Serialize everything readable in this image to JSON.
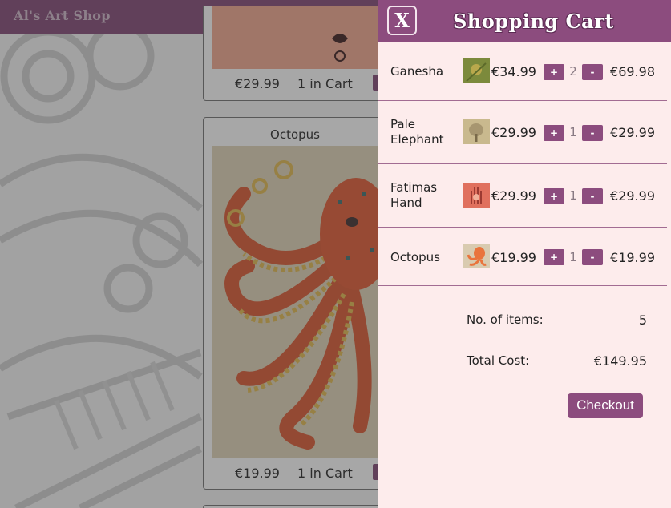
{
  "shop": {
    "brand": "Al's Art Shop",
    "products": [
      {
        "price": "€29.99",
        "in_cart": "1 in Cart"
      },
      {
        "title": "Octopus",
        "price": "€19.99",
        "in_cart": "1 in Cart"
      }
    ]
  },
  "cart": {
    "close_label": "X",
    "title": "Shopping Cart",
    "plus_label": "+",
    "minus_label": "-",
    "items": [
      {
        "name": "Ganesha",
        "unit_price": "€34.99",
        "qty": "2",
        "line_total": "€69.98",
        "thumb_color": "#7c8a3c"
      },
      {
        "name": "Pale Elephant",
        "unit_price": "€29.99",
        "qty": "1",
        "line_total": "€29.99",
        "thumb_color": "#c9b98e"
      },
      {
        "name": "Fatimas Hand",
        "unit_price": "€29.99",
        "qty": "1",
        "line_total": "€29.99",
        "thumb_color": "#e0705e"
      },
      {
        "name": "Octopus",
        "unit_price": "€19.99",
        "qty": "1",
        "line_total": "€19.99",
        "thumb_color": "#e9743c"
      }
    ],
    "summary": {
      "items_label": "No. of items:",
      "items_value": "5",
      "total_label": "Total Cost:",
      "total_value": "€149.95"
    },
    "checkout_label": "Checkout"
  },
  "colors": {
    "accent": "#8c4c7e",
    "panel_bg": "#fdecec",
    "topbar": "#7d4470"
  }
}
